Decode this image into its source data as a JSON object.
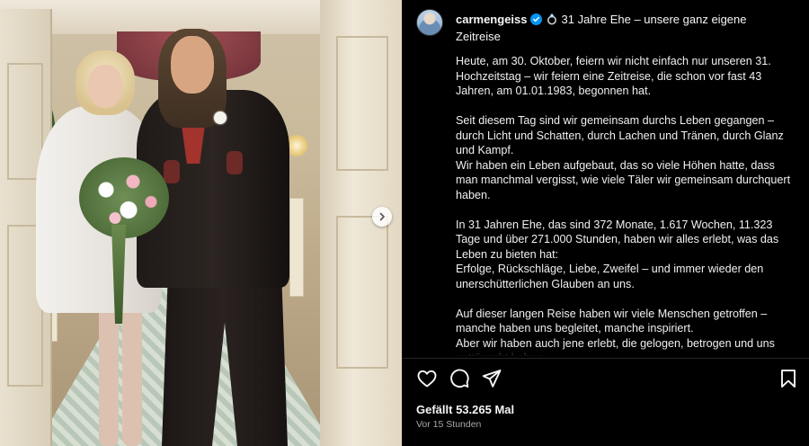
{
  "post": {
    "username": "carmengeiss",
    "verified": true,
    "title": "31 Jahre Ehe – unsere ganz eigene Zeitreise",
    "paragraphs": [
      "Heute, am 30. Oktober, feiern wir nicht einfach nur unseren 31. Hochzeitstag – wir feiern eine Zeitreise, die schon vor fast 43 Jahren, am 01.01.1983, begonnen hat.",
      "Seit diesem Tag sind wir gemeinsam durchs Leben gegangen – durch Licht und Schatten, durch Lachen und Tränen, durch Glanz und Kampf.",
      "Wir haben ein Leben aufgebaut, das so viele Höhen hatte, dass man manchmal vergisst, wie viele Täler wir gemeinsam durchquert haben.",
      "In 31 Jahren Ehe, das sind 372 Monate, 1.617 Wochen, 11.323 Tage und über 271.000 Stunden, haben wir alles erlebt, was das Leben zu bieten hat:",
      "Erfolge, Rückschläge, Liebe, Zweifel – und immer wieder den unerschütterlichen Glauben an uns.",
      "Auf dieser langen Reise haben wir viele Menschen getroffen – manche haben uns begleitet, manche inspiriert.",
      "Aber wir haben auch jene erlebt, die gelogen, betrogen und uns enttäuscht haben."
    ],
    "likes_text": "Gefällt 53.265 Mal",
    "time_text": "Vor 15 Stunden"
  },
  "icons": {
    "like": "heart-icon",
    "comment": "comment-icon",
    "share": "paper-plane-icon",
    "save": "bookmark-icon",
    "carousel_next": "chevron-right-icon",
    "verified": "verified-badge-icon",
    "ring": "ring-emoji-icon"
  },
  "colors": {
    "background": "#000000",
    "text": "#f5f5f5",
    "muted": "#a8a8a8",
    "verified": "#0095f6"
  }
}
